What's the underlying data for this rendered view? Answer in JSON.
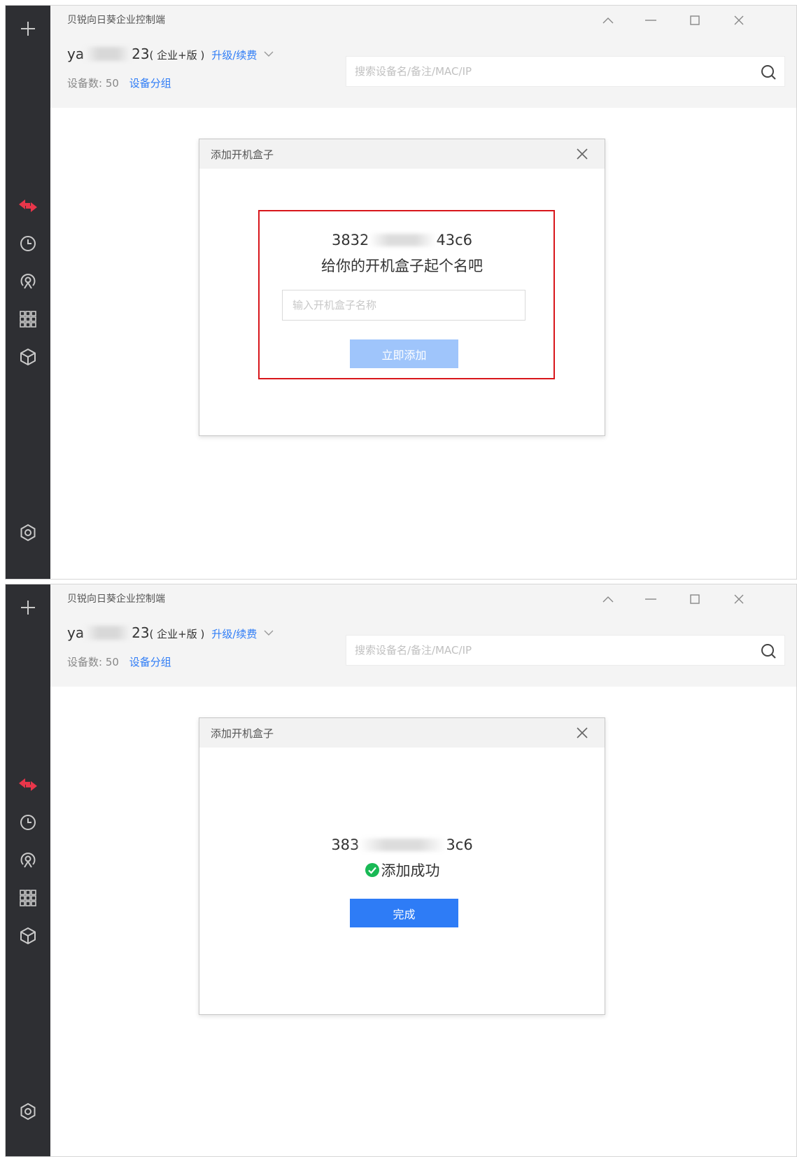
{
  "app": {
    "title": "贝锐向日葵企业控制端",
    "account_prefix": "ya",
    "account_suffix": "23",
    "edition": "( 企业+版 )",
    "upgrade_label": "升级/续费",
    "device_count_label": "设备数: 50",
    "device_group_label": "设备分组",
    "search_placeholder": "搜索设备名/备注/MAC/IP"
  },
  "sidebar": {
    "icons": [
      "plus-icon",
      "remote-control-icon",
      "history-icon",
      "discover-icon",
      "apps-icon",
      "box-icon",
      "settings-icon"
    ],
    "active_color": "#e8364a"
  },
  "dialog1": {
    "title": "添加开机盒子",
    "device_id_prefix": "3832",
    "device_id_suffix": "43c6",
    "subtitle": "给你的开机盒子起个名吧",
    "name_placeholder": "输入开机盒子名称",
    "add_button": "立即添加"
  },
  "dialog2": {
    "title": "添加开机盒子",
    "device_id_prefix": "383",
    "device_id_suffix": "3c6",
    "success_text": "添加成功",
    "done_button": "完成"
  },
  "colors": {
    "accent": "#2e7cf6",
    "sidebar": "#2e2f33",
    "highlight_border": "#d8161b",
    "success": "#19b955"
  }
}
